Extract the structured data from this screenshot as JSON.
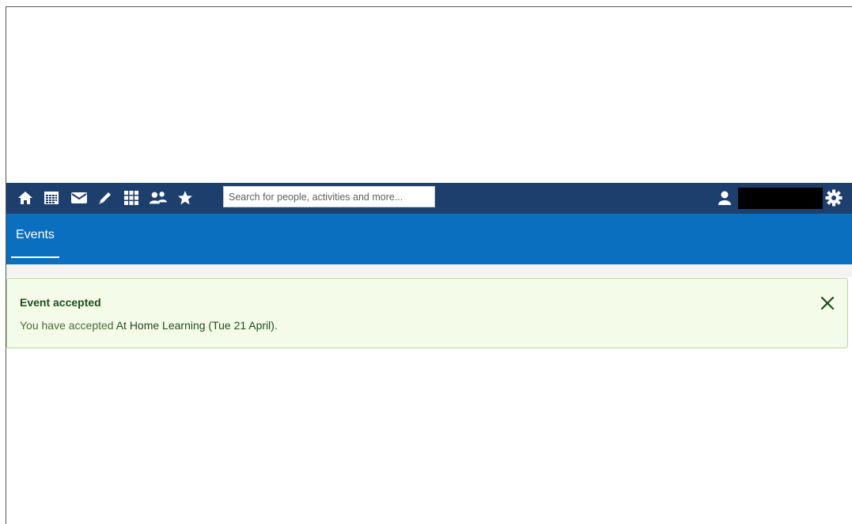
{
  "topbar": {
    "icons": [
      "home-icon",
      "calendar-icon",
      "mail-icon",
      "pencil-icon",
      "grid-icon",
      "people-icon",
      "star-icon",
      "user-icon",
      "gear-icon"
    ],
    "search": {
      "placeholder": "Search for people, activities and more...",
      "value": ""
    },
    "colors": {
      "background": "#1d3f6e",
      "subbar": "#0a6fbf"
    }
  },
  "subbar": {
    "tab_label": "Events"
  },
  "alert": {
    "title": "Event accepted",
    "message_prefix": "You have accepted ",
    "event_name": "At Home Learning (Tue 21 April)",
    "message_suffix": ".",
    "close_icon": "close-icon",
    "colors": {
      "background": "#f4fbe8",
      "border": "#b9d79a",
      "text": "#1f4d1f"
    }
  }
}
